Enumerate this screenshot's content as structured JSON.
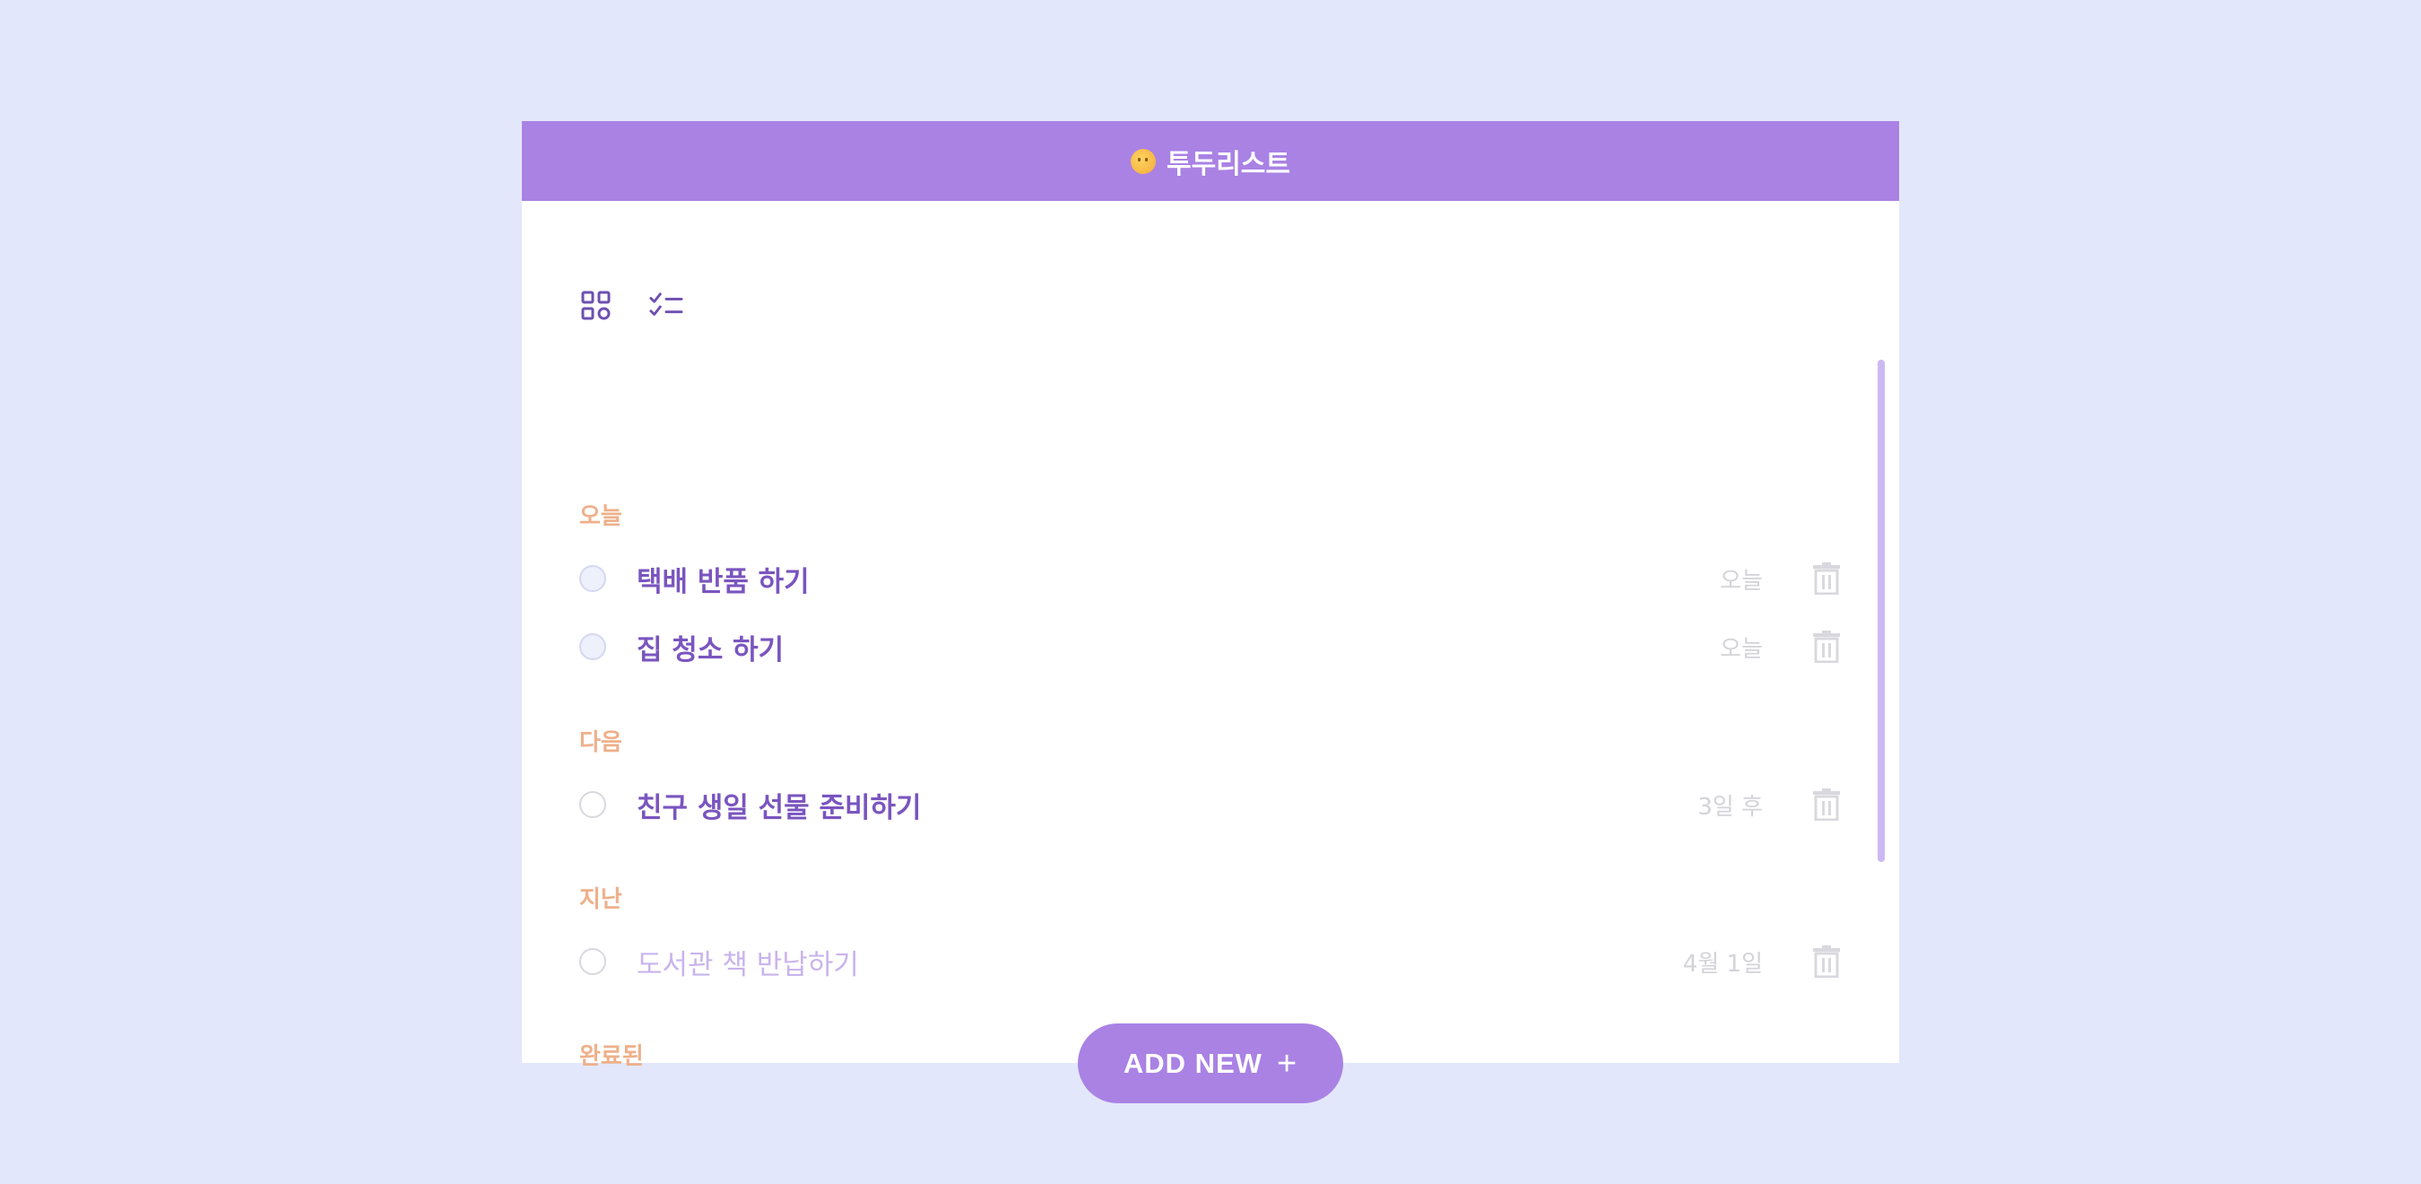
{
  "app": {
    "title": "투두리스트",
    "title_icon": "sun-face-icon"
  },
  "toolbar": {
    "views": [
      {
        "icon": "grid-view-icon"
      },
      {
        "icon": "checklist-view-icon"
      }
    ]
  },
  "groups": [
    {
      "title": "오늘",
      "tasks": [
        {
          "title": "택배 반품 하기",
          "date": "오늘",
          "done": false
        },
        {
          "title": "집 청소 하기",
          "date": "오늘",
          "done": false
        }
      ]
    },
    {
      "title": "다음",
      "tasks": [
        {
          "title": "친구 생일 선물 준비하기",
          "date": "3일 후",
          "done": false
        }
      ]
    },
    {
      "title": "지난",
      "tasks": [
        {
          "title": "도서관 책 반납하기",
          "date": "4월 1일",
          "done": false
        }
      ]
    },
    {
      "title": "완료된",
      "tasks": []
    }
  ],
  "actions": {
    "add_new_label": "ADD NEW",
    "add_new_icon": "plus-icon"
  },
  "colors": {
    "background": "#e3e7fc",
    "accent": "#a982e4",
    "task_text": "#7a55bf",
    "group_title": "#eeb08a",
    "muted": "#d3d3d8"
  }
}
